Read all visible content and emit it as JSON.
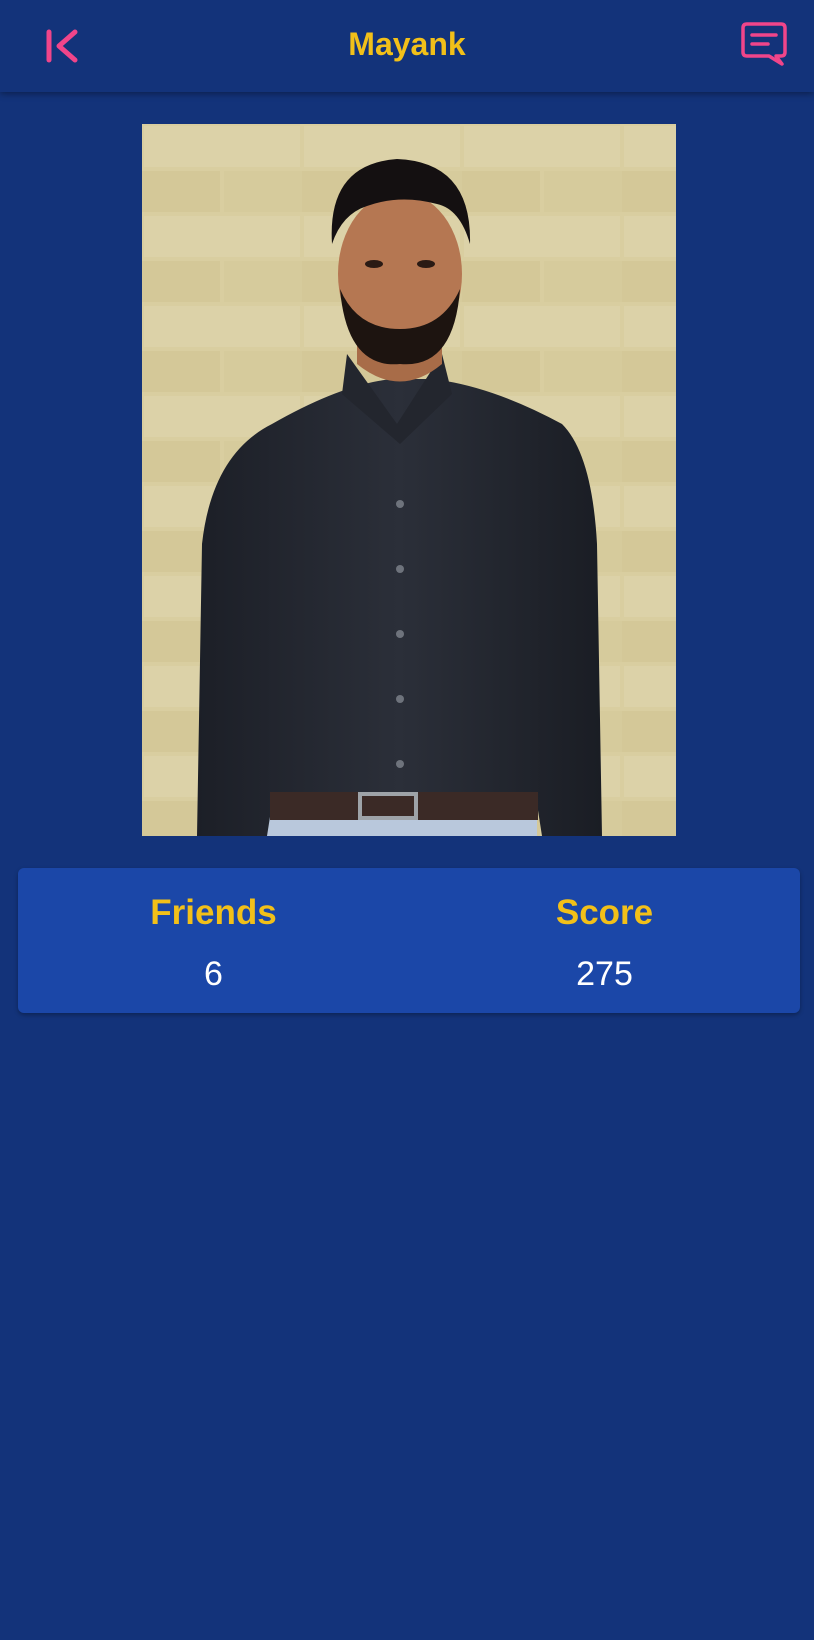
{
  "header": {
    "title": "Mayank",
    "back_icon": "back-chevron-bar-icon",
    "chat_icon": "chat-bubble-icon"
  },
  "profile": {
    "photo_alt": "Mayank"
  },
  "stats": [
    {
      "label": "Friends",
      "value": "6"
    },
    {
      "label": "Score",
      "value": "275"
    }
  ],
  "colors": {
    "background": "#13337a",
    "card": "#1b47a8",
    "accent_yellow": "#f2c019",
    "icon_pink": "#f0458a",
    "text_white": "#ffffff"
  }
}
